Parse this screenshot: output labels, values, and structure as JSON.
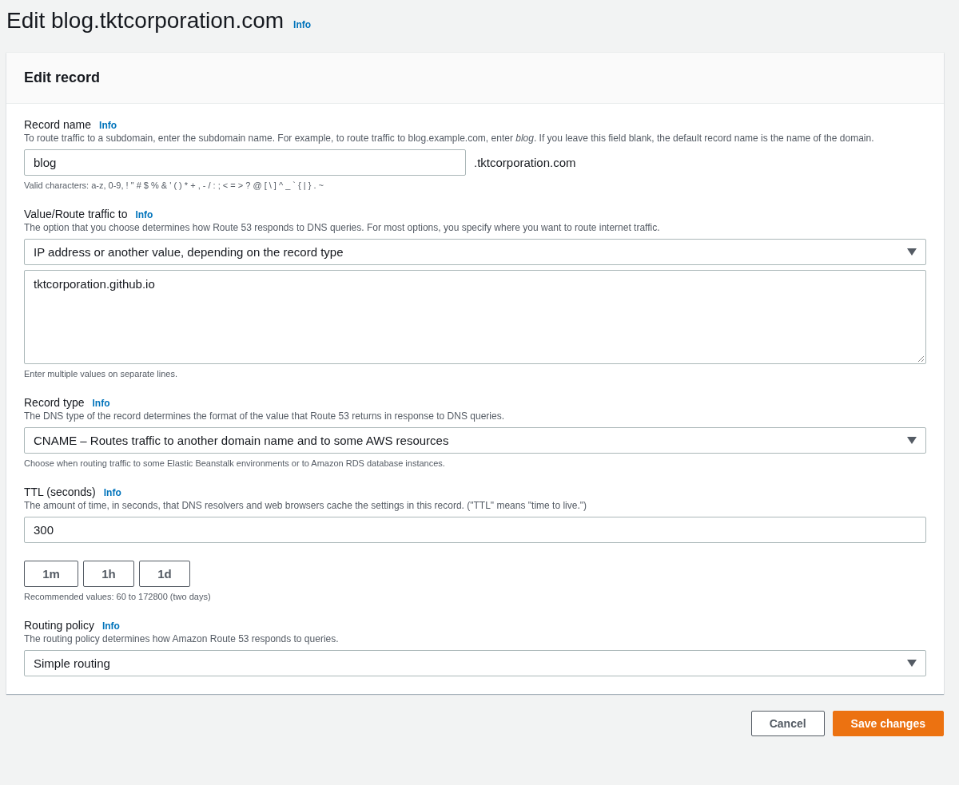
{
  "page": {
    "title": "Edit blog.tktcorporation.com",
    "info": "Info"
  },
  "card": {
    "title": "Edit record",
    "fields": [
      {
        "label": "Record name",
        "info": "Info",
        "description": "To route traffic to a subdomain, enter the subdomain name. For example, to route traffic to blog.example.com, enter *blog*. If you leave this field blank, the default record name is the name of the domain.",
        "controls": [
          {
            "kind": "input",
            "value": "blog",
            "suffix": ".tktcorporation.com"
          }
        ],
        "hint": "Valid characters: a-z, 0-9, ! \" # $ % & ' ( ) * + , - / : ; < = > ? @ [ \\ ] ^ _ ` { | } . ~"
      },
      {
        "label": "Value/Route traffic to",
        "info": "Info",
        "description": "The option that you choose determines how Route 53 responds to DNS queries. For most options, you specify where you want to route internet traffic.",
        "controls": [
          {
            "kind": "select",
            "value": "IP address or another value, depending on the record type"
          },
          {
            "kind": "textarea",
            "value": "tktcorporation.github.io"
          }
        ],
        "hint": "Enter multiple values on separate lines."
      },
      {
        "label": "Record type",
        "info": "Info",
        "description": "The DNS type of the record determines the format of the value that Route 53 returns in response to DNS queries.",
        "controls": [
          {
            "kind": "select",
            "value": "CNAME – Routes traffic to another domain name and to some AWS resources"
          }
        ],
        "hint": "Choose when routing traffic to some Elastic Beanstalk environments or to Amazon RDS database instances."
      },
      {
        "label": "TTL (seconds)",
        "info": "Info",
        "description": "The amount of time, in seconds, that DNS resolvers and web browsers cache the settings in this record. (\"TTL\" means \"time to live.\")",
        "controls": [
          {
            "kind": "input",
            "value": "300"
          },
          {
            "kind": "presets",
            "buttons": [
              "1m",
              "1h",
              "1d"
            ]
          }
        ],
        "hint": "Recommended values: 60 to 172800 (two days)"
      },
      {
        "label": "Routing policy",
        "info": "Info",
        "description": "The routing policy determines how Amazon Route 53 responds to queries.",
        "controls": [
          {
            "kind": "select",
            "value": "Simple routing"
          }
        ]
      }
    ]
  },
  "actions": [
    {
      "label": "Cancel",
      "kind": "secondary"
    },
    {
      "label": "Save changes",
      "kind": "primary"
    }
  ]
}
